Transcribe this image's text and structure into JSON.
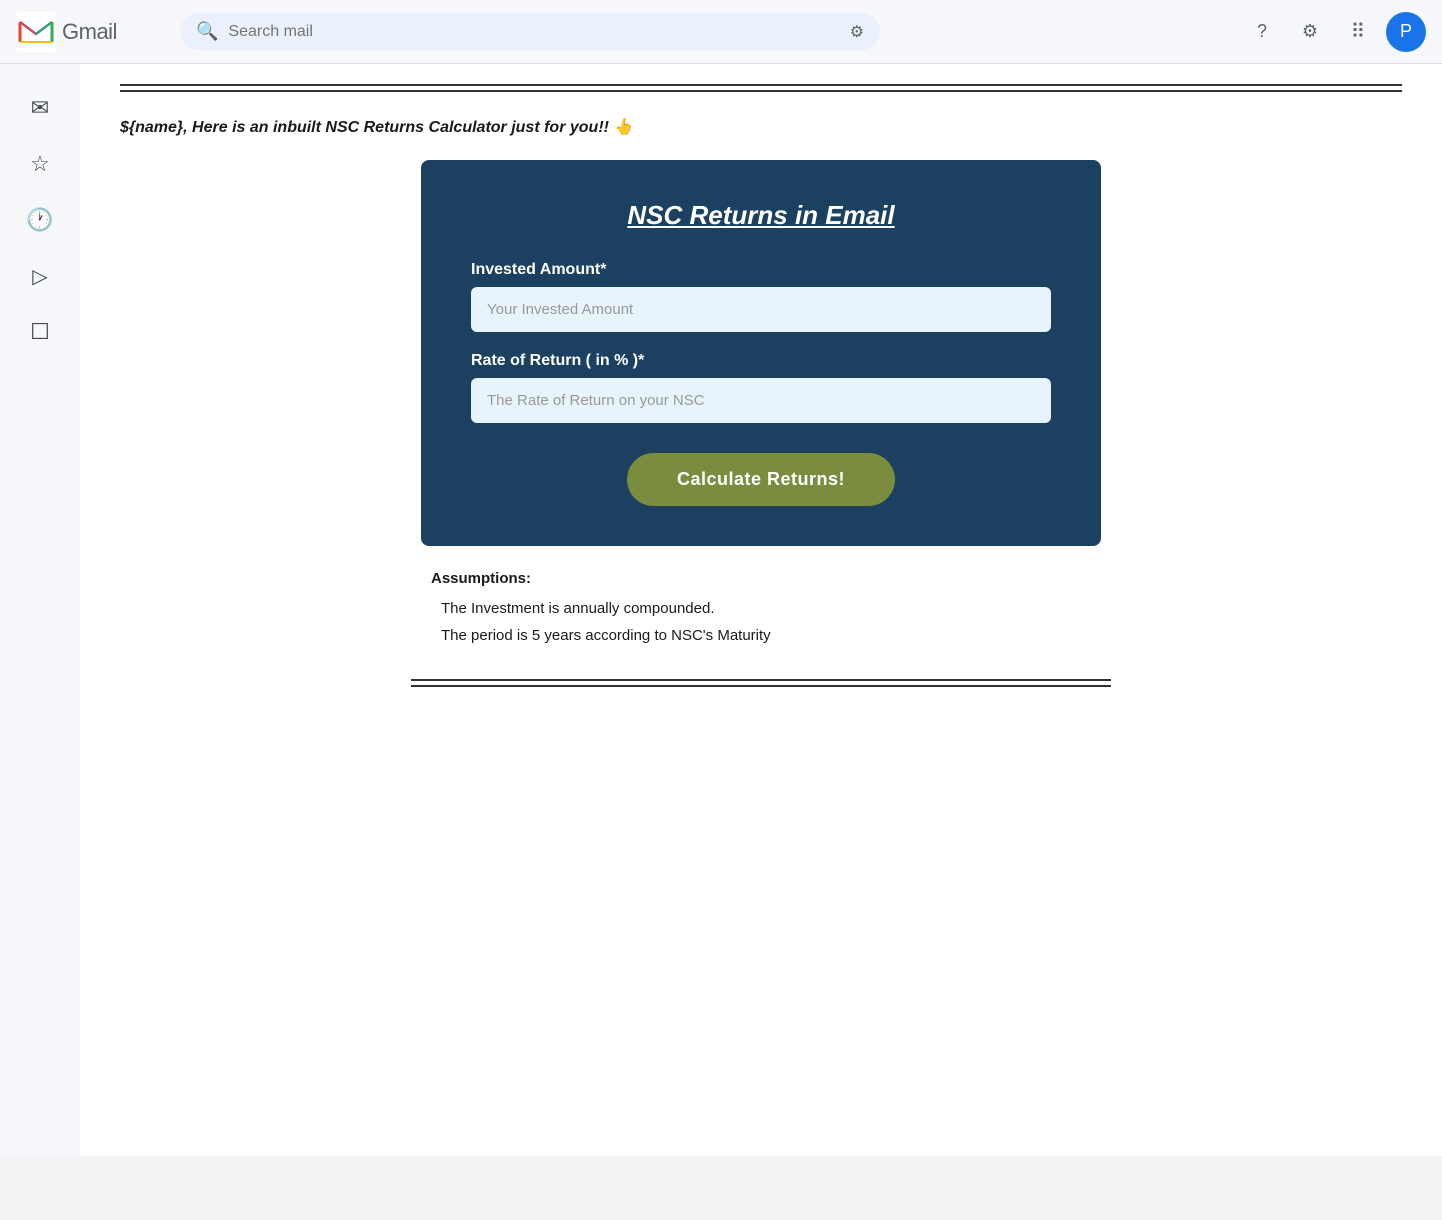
{
  "app": {
    "name": "Gmail"
  },
  "topbar": {
    "search_placeholder": "Search mail",
    "avatar_label": "P",
    "filter_icon": "⊞",
    "help_icon": "?",
    "settings_icon": "⚙",
    "apps_icon": "⠿"
  },
  "sidebar": {
    "items": [
      {
        "name": "compose-icon",
        "icon": "✉",
        "label": "Compose"
      },
      {
        "name": "star-icon",
        "icon": "☆",
        "label": "Starred"
      },
      {
        "name": "clock-icon",
        "icon": "🕐",
        "label": "Snoozed"
      },
      {
        "name": "send-icon",
        "icon": "▷",
        "label": "Sent"
      },
      {
        "name": "draft-icon",
        "icon": "☐",
        "label": "Drafts"
      }
    ]
  },
  "email": {
    "intro_text": "${name}, Here is an inbuilt NSC Returns Calculator just for you!! 👆",
    "nsc_card": {
      "title": "NSC Returns in Email",
      "invested_amount_label": "Invested Amount*",
      "invested_amount_placeholder": "Your Invested Amount",
      "rate_of_return_label": "Rate of Return ( in % )*",
      "rate_of_return_placeholder": "The Rate of Return on your NSC",
      "calculate_button_label": "Calculate Returns!"
    },
    "assumptions": {
      "title": "Assumptions:",
      "items": [
        "The Investment is annually compounded.",
        "The period is 5 years according to NSC's Maturity"
      ]
    }
  }
}
